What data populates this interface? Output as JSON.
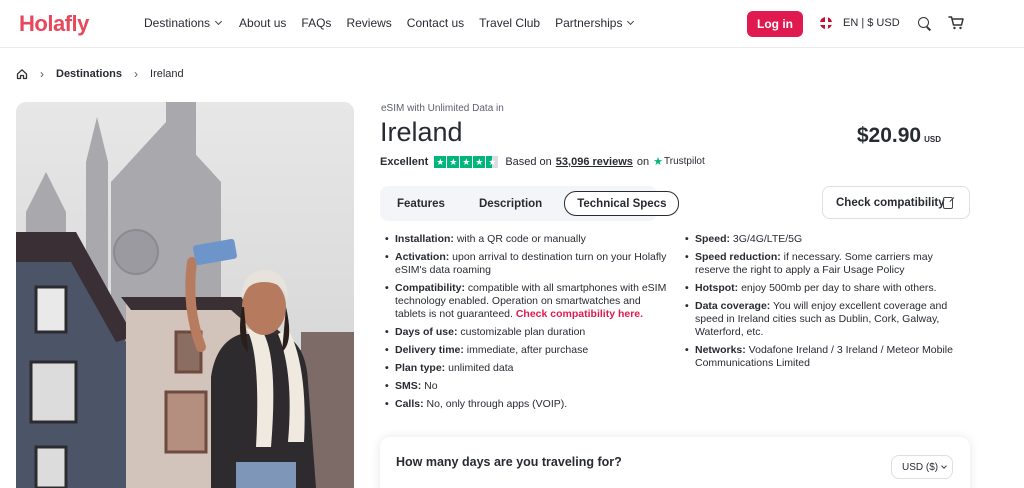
{
  "nav": {
    "logo": "Holafly",
    "links": [
      {
        "label": "Destinations",
        "dropdown": true
      },
      {
        "label": "About us",
        "dropdown": false
      },
      {
        "label": "FAQs",
        "dropdown": false
      },
      {
        "label": "Reviews",
        "dropdown": false
      },
      {
        "label": "Contact us",
        "dropdown": false
      },
      {
        "label": "Travel Club",
        "dropdown": false
      },
      {
        "label": "Partnerships",
        "dropdown": true
      }
    ],
    "login": "Log in",
    "locale": "EN | $ USD",
    "brand_color": "#e01a4f"
  },
  "breadcrumb": {
    "items": [
      "Destinations",
      "Ireland"
    ]
  },
  "product": {
    "eyebrow": "eSIM with Unlimited Data in",
    "title": "Ireland",
    "price": "$20.90",
    "price_currency": "USD",
    "rating": {
      "label": "Excellent",
      "based_on": "Based on",
      "reviews": "53,096 reviews",
      "on": "on",
      "provider": "Trustpilot",
      "stars": 4.5
    }
  },
  "tabs": {
    "items": [
      "Features",
      "Description",
      "Technical Specs"
    ],
    "active": 2
  },
  "compat_button": "Check compatibility",
  "specs_left": [
    {
      "key": "Installation:",
      "value": " with a QR code or manually"
    },
    {
      "key": "Activation:",
      "value": " upon arrival to destination turn on your Holafly eSIM's data roaming"
    },
    {
      "key": "Compatibility:",
      "value": " compatible with all smartphones with eSIM technology enabled. Operation on smartwatches and tablets is not guaranteed. ",
      "link": "Check compatibility here."
    },
    {
      "key": "Days of use:",
      "value": " customizable plan duration"
    },
    {
      "key": "Delivery time:",
      "value": " immediate, after purchase"
    },
    {
      "key": "Plan type:",
      "value": " unlimited data"
    },
    {
      "key": "SMS:",
      "value": " No"
    },
    {
      "key": "Calls:",
      "value": " No, only through apps (VOIP)."
    }
  ],
  "specs_right": [
    {
      "key": "Speed:",
      "value": " 3G/4G/LTE/5G"
    },
    {
      "key": "Speed reduction:",
      "value": " if necessary. Some carriers may reserve the right to apply a Fair Usage Policy"
    },
    {
      "key": "Hotspot:",
      "value": " enjoy 500mb per day to share with others."
    },
    {
      "key": "Data coverage:",
      "value": " You will enjoy excellent coverage and speed in Ireland cities such as Dublin, Cork, Galway, Waterford, etc."
    },
    {
      "key": "Networks:",
      "value": " Vodafone Ireland / 3 Ireland / Meteor Mobile Communications Limited"
    }
  ],
  "days": {
    "question": "How many days are you traveling for?",
    "currency_select": "USD ($)"
  }
}
